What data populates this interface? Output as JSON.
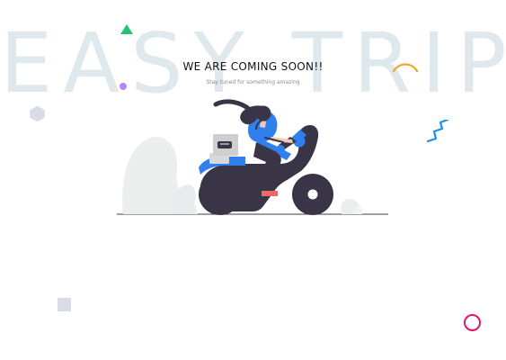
{
  "page": {
    "background_text": "EASY TRIP",
    "heading": "WE ARE COMING SOON!!",
    "subheading": "Stay tuned for something amazing"
  },
  "colors": {
    "background": "#ffffff",
    "background_text": "#dfe8ec",
    "triangle": "#27c26d",
    "dot": "#b388f2",
    "hexagon": "#d9dce6",
    "arc": "#f2a62d",
    "zigzag": "#1b8ee8",
    "ring": "#e4126f",
    "scooter": "#3a3546",
    "accent": "#2f80ed"
  },
  "icons": [
    "triangle-icon",
    "dot-icon",
    "hexagon-icon",
    "arc-icon",
    "zigzag-icon",
    "square-icon",
    "ring-icon",
    "scooter-illustration"
  ]
}
